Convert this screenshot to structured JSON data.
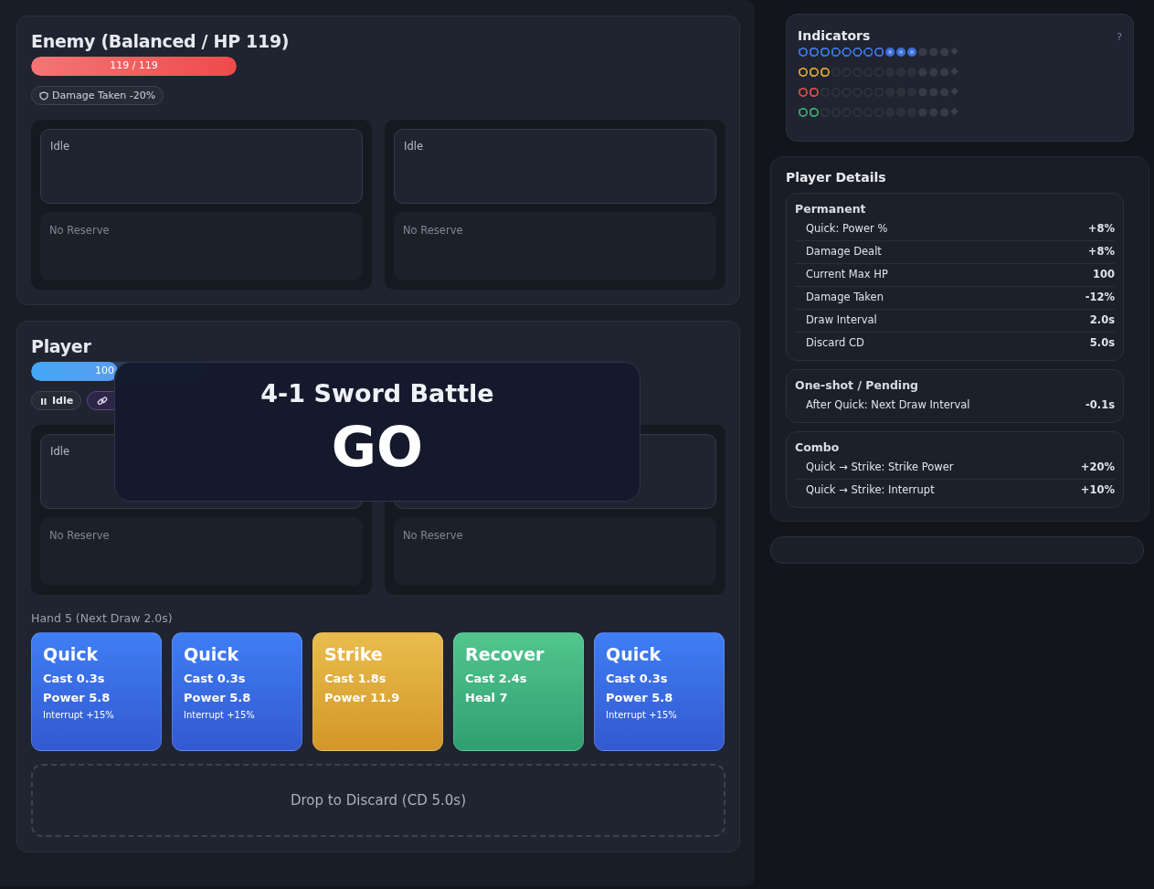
{
  "enemy": {
    "title": "Enemy (Balanced / HP 119)",
    "hp": {
      "label": "119 / 119",
      "level": 1
    },
    "chips": [
      {
        "label": "Damage Taken -20%",
        "kind": "shield"
      }
    ],
    "slots": [
      {
        "status": "Idle",
        "reserve": "No Reserve"
      },
      {
        "status": "Idle",
        "reserve": "No Reserve"
      }
    ]
  },
  "player": {
    "title": "Player",
    "hp": {
      "label": "100",
      "level": 0.5
    },
    "chips": [
      {
        "label": "Idle",
        "kind": "pause"
      },
      {
        "kind": "link"
      }
    ],
    "slots": [
      {
        "status": "Idle",
        "reserve": "No Reserve"
      },
      {
        "reserve": "No Reserve"
      }
    ],
    "hand_label": "Hand 5 (Next Draw 2.0s)",
    "cards": [
      {
        "kind": "quick",
        "name": "Quick",
        "lines": [
          "Cast 0.3s",
          "Power 5.8"
        ],
        "note": "Interrupt +15%"
      },
      {
        "kind": "quick",
        "name": "Quick",
        "lines": [
          "Cast 0.3s",
          "Power 5.8"
        ],
        "note": "Interrupt +15%"
      },
      {
        "kind": "strike",
        "name": "Strike",
        "lines": [
          "Cast 1.8s",
          "Power 11.9"
        ]
      },
      {
        "kind": "recover",
        "name": "Recover",
        "lines": [
          "Cast 2.4s",
          "Heal 7"
        ]
      },
      {
        "kind": "quick",
        "name": "Quick",
        "lines": [
          "Cast 0.3s",
          "Power 5.8"
        ],
        "note": "Interrupt +15%"
      }
    ],
    "discard": "Drop to Discard (CD 5.0s)"
  },
  "overlay": {
    "subtitle": "4-1 Sword Battle",
    "title": "GO"
  },
  "indicators": {
    "title": "Indicators",
    "help": "?",
    "rows": [
      {
        "color": "#3b6fd8",
        "marks": [
          {
            "kind": "ring",
            "on": true
          },
          {
            "kind": "ring",
            "on": true
          },
          {
            "kind": "ring",
            "on": true
          },
          {
            "kind": "ring",
            "on": true
          },
          {
            "kind": "ring",
            "on": true
          },
          {
            "kind": "ring",
            "on": true
          },
          {
            "kind": "ring",
            "on": true
          },
          {
            "kind": "ring",
            "on": true
          },
          {
            "kind": "core",
            "on": true
          },
          {
            "kind": "core",
            "on": true
          },
          {
            "kind": "core",
            "on": true
          },
          {
            "kind": "dot",
            "on": false
          },
          {
            "kind": "dot",
            "on": false
          },
          {
            "kind": "dot",
            "on": false
          },
          {
            "kind": "diamond",
            "on": false
          }
        ]
      },
      {
        "color": "#c9962f",
        "marks": [
          {
            "kind": "ring",
            "on": true
          },
          {
            "kind": "ring",
            "on": true
          },
          {
            "kind": "ring",
            "on": true
          },
          {
            "kind": "ring",
            "on": false
          },
          {
            "kind": "ring",
            "on": false
          },
          {
            "kind": "ring",
            "on": false
          },
          {
            "kind": "ring",
            "on": false
          },
          {
            "kind": "ring",
            "on": false
          },
          {
            "kind": "core",
            "on": false
          },
          {
            "kind": "core",
            "on": false
          },
          {
            "kind": "core",
            "on": false
          },
          {
            "kind": "dot",
            "on": false
          },
          {
            "kind": "dot",
            "on": false
          },
          {
            "kind": "dot",
            "on": false
          },
          {
            "kind": "diamond",
            "on": false
          }
        ]
      },
      {
        "color": "#c84848",
        "marks": [
          {
            "kind": "ring",
            "on": true
          },
          {
            "kind": "ring",
            "on": true
          },
          {
            "kind": "ring",
            "on": false
          },
          {
            "kind": "ring",
            "on": false
          },
          {
            "kind": "ring",
            "on": false
          },
          {
            "kind": "ring",
            "on": false
          },
          {
            "kind": "ring",
            "on": false
          },
          {
            "kind": "ring",
            "on": false
          },
          {
            "kind": "core",
            "on": false
          },
          {
            "kind": "core",
            "on": false
          },
          {
            "kind": "core",
            "on": false
          },
          {
            "kind": "dot",
            "on": false
          },
          {
            "kind": "dot",
            "on": false
          },
          {
            "kind": "dot",
            "on": false
          },
          {
            "kind": "diamond",
            "on": false
          }
        ]
      },
      {
        "color": "#3a9a70",
        "marks": [
          {
            "kind": "ring",
            "on": true
          },
          {
            "kind": "ring",
            "on": true
          },
          {
            "kind": "ring",
            "on": false
          },
          {
            "kind": "ring",
            "on": false
          },
          {
            "kind": "ring",
            "on": false
          },
          {
            "kind": "ring",
            "on": false
          },
          {
            "kind": "ring",
            "on": false
          },
          {
            "kind": "ring",
            "on": false
          },
          {
            "kind": "core",
            "on": false
          },
          {
            "kind": "core",
            "on": false
          },
          {
            "kind": "core",
            "on": false
          },
          {
            "kind": "dot",
            "on": false
          },
          {
            "kind": "dot",
            "on": false
          },
          {
            "kind": "dot",
            "on": false
          },
          {
            "kind": "diamond",
            "on": false
          }
        ]
      }
    ]
  },
  "details": {
    "title": "Player Details",
    "sections": [
      {
        "title": "Permanent",
        "rows": [
          {
            "label": "Quick: Power %",
            "value": "+8%"
          },
          {
            "label": "Damage Dealt",
            "value": "+8%"
          },
          {
            "label": "Current Max HP",
            "value": "100"
          },
          {
            "label": "Damage Taken",
            "value": "-12%"
          },
          {
            "label": "Draw Interval",
            "value": "2.0s"
          },
          {
            "label": "Discard CD",
            "value": "5.0s"
          }
        ]
      },
      {
        "title": "One-shot / Pending",
        "rows": [
          {
            "label": "After Quick: Next Draw Interval",
            "value": "-0.1s"
          }
        ]
      },
      {
        "title": "Combo",
        "rows": [
          {
            "label": "Quick → Strike: Strike Power",
            "value": "+20%"
          },
          {
            "label": "Quick → Strike: Interrupt",
            "value": "+10%"
          }
        ]
      }
    ]
  }
}
